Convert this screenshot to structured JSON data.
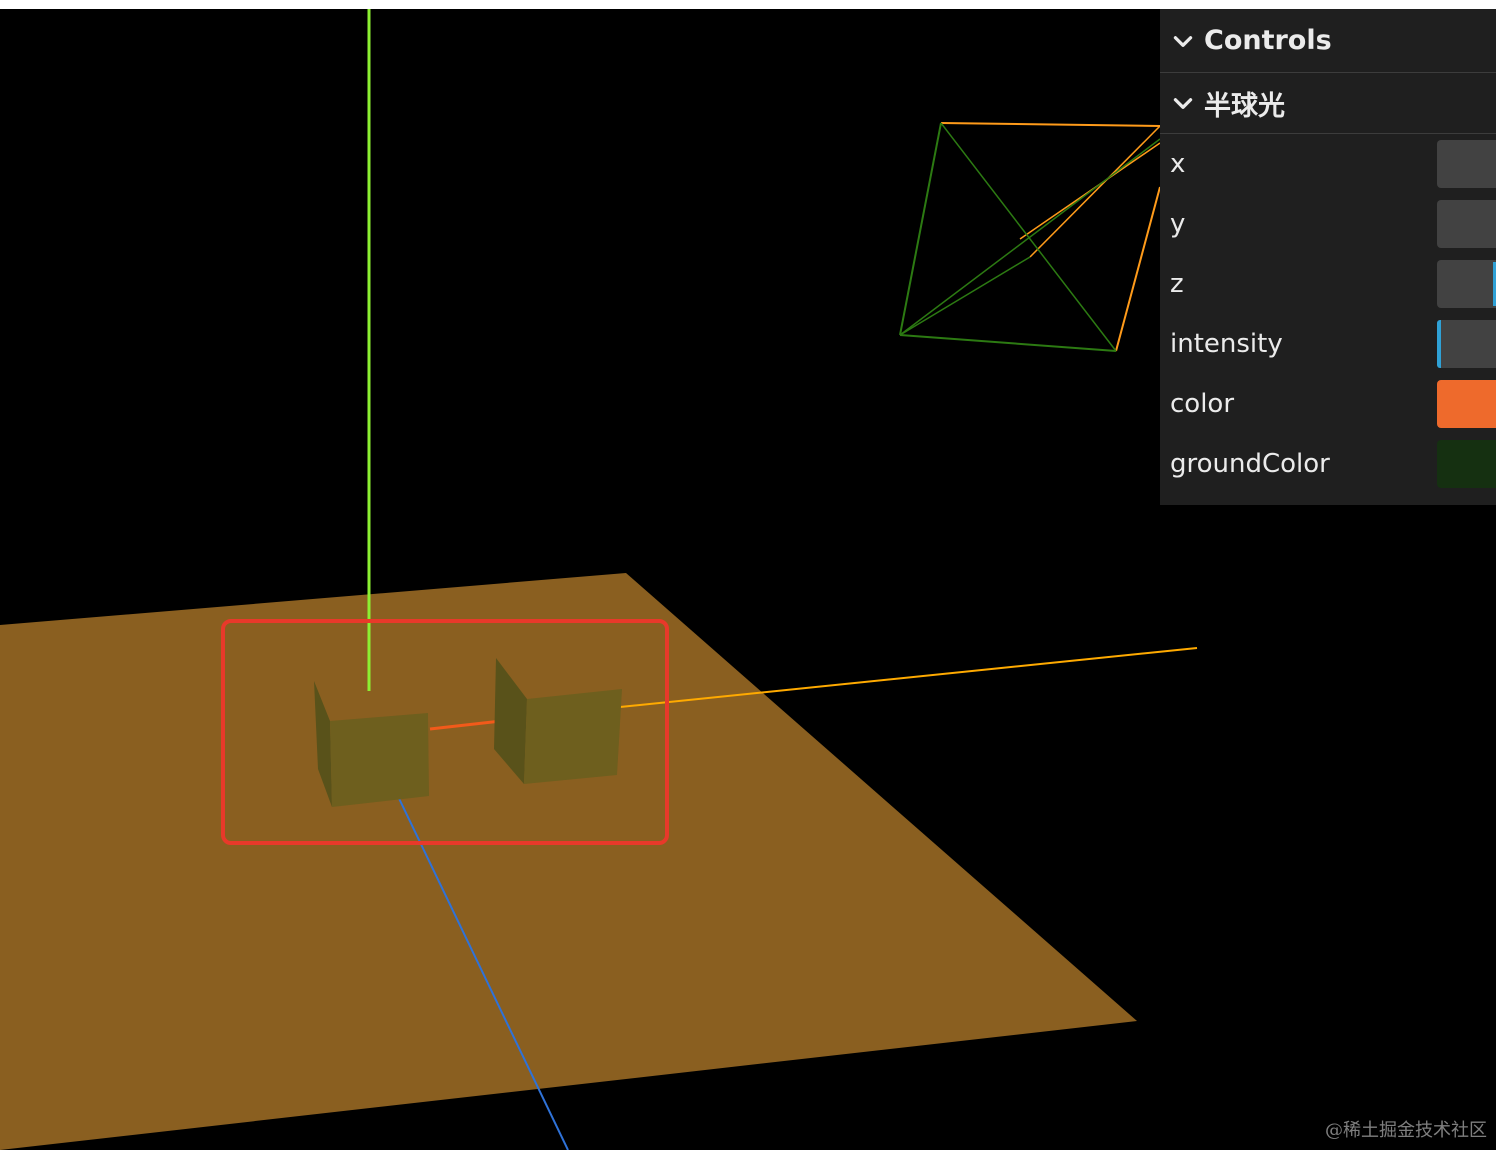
{
  "gui": {
    "title": "Controls",
    "folder": {
      "title": "半球光",
      "controls": [
        {
          "label": "x",
          "kind": "number"
        },
        {
          "label": "y",
          "kind": "number"
        },
        {
          "label": "z",
          "kind": "number"
        },
        {
          "label": "intensity",
          "kind": "slider"
        },
        {
          "label": "color",
          "kind": "color",
          "value": "#ee6a2c"
        },
        {
          "label": "groundColor",
          "kind": "color",
          "value": "#153011"
        }
      ]
    }
  },
  "scene": {
    "ground_plane_color": "#8a5f20",
    "box_color": "#6b5a1a",
    "y_axis_color": "#7fff00",
    "x_axis_color": "#ff8a00",
    "z_axis_color": "#2a6fdb",
    "light_helper_colors": [
      "#ff9b1a",
      "#2c7a12"
    ],
    "highlight_color": "#e8392a"
  },
  "watermark": "@稀土掘金技术社区"
}
